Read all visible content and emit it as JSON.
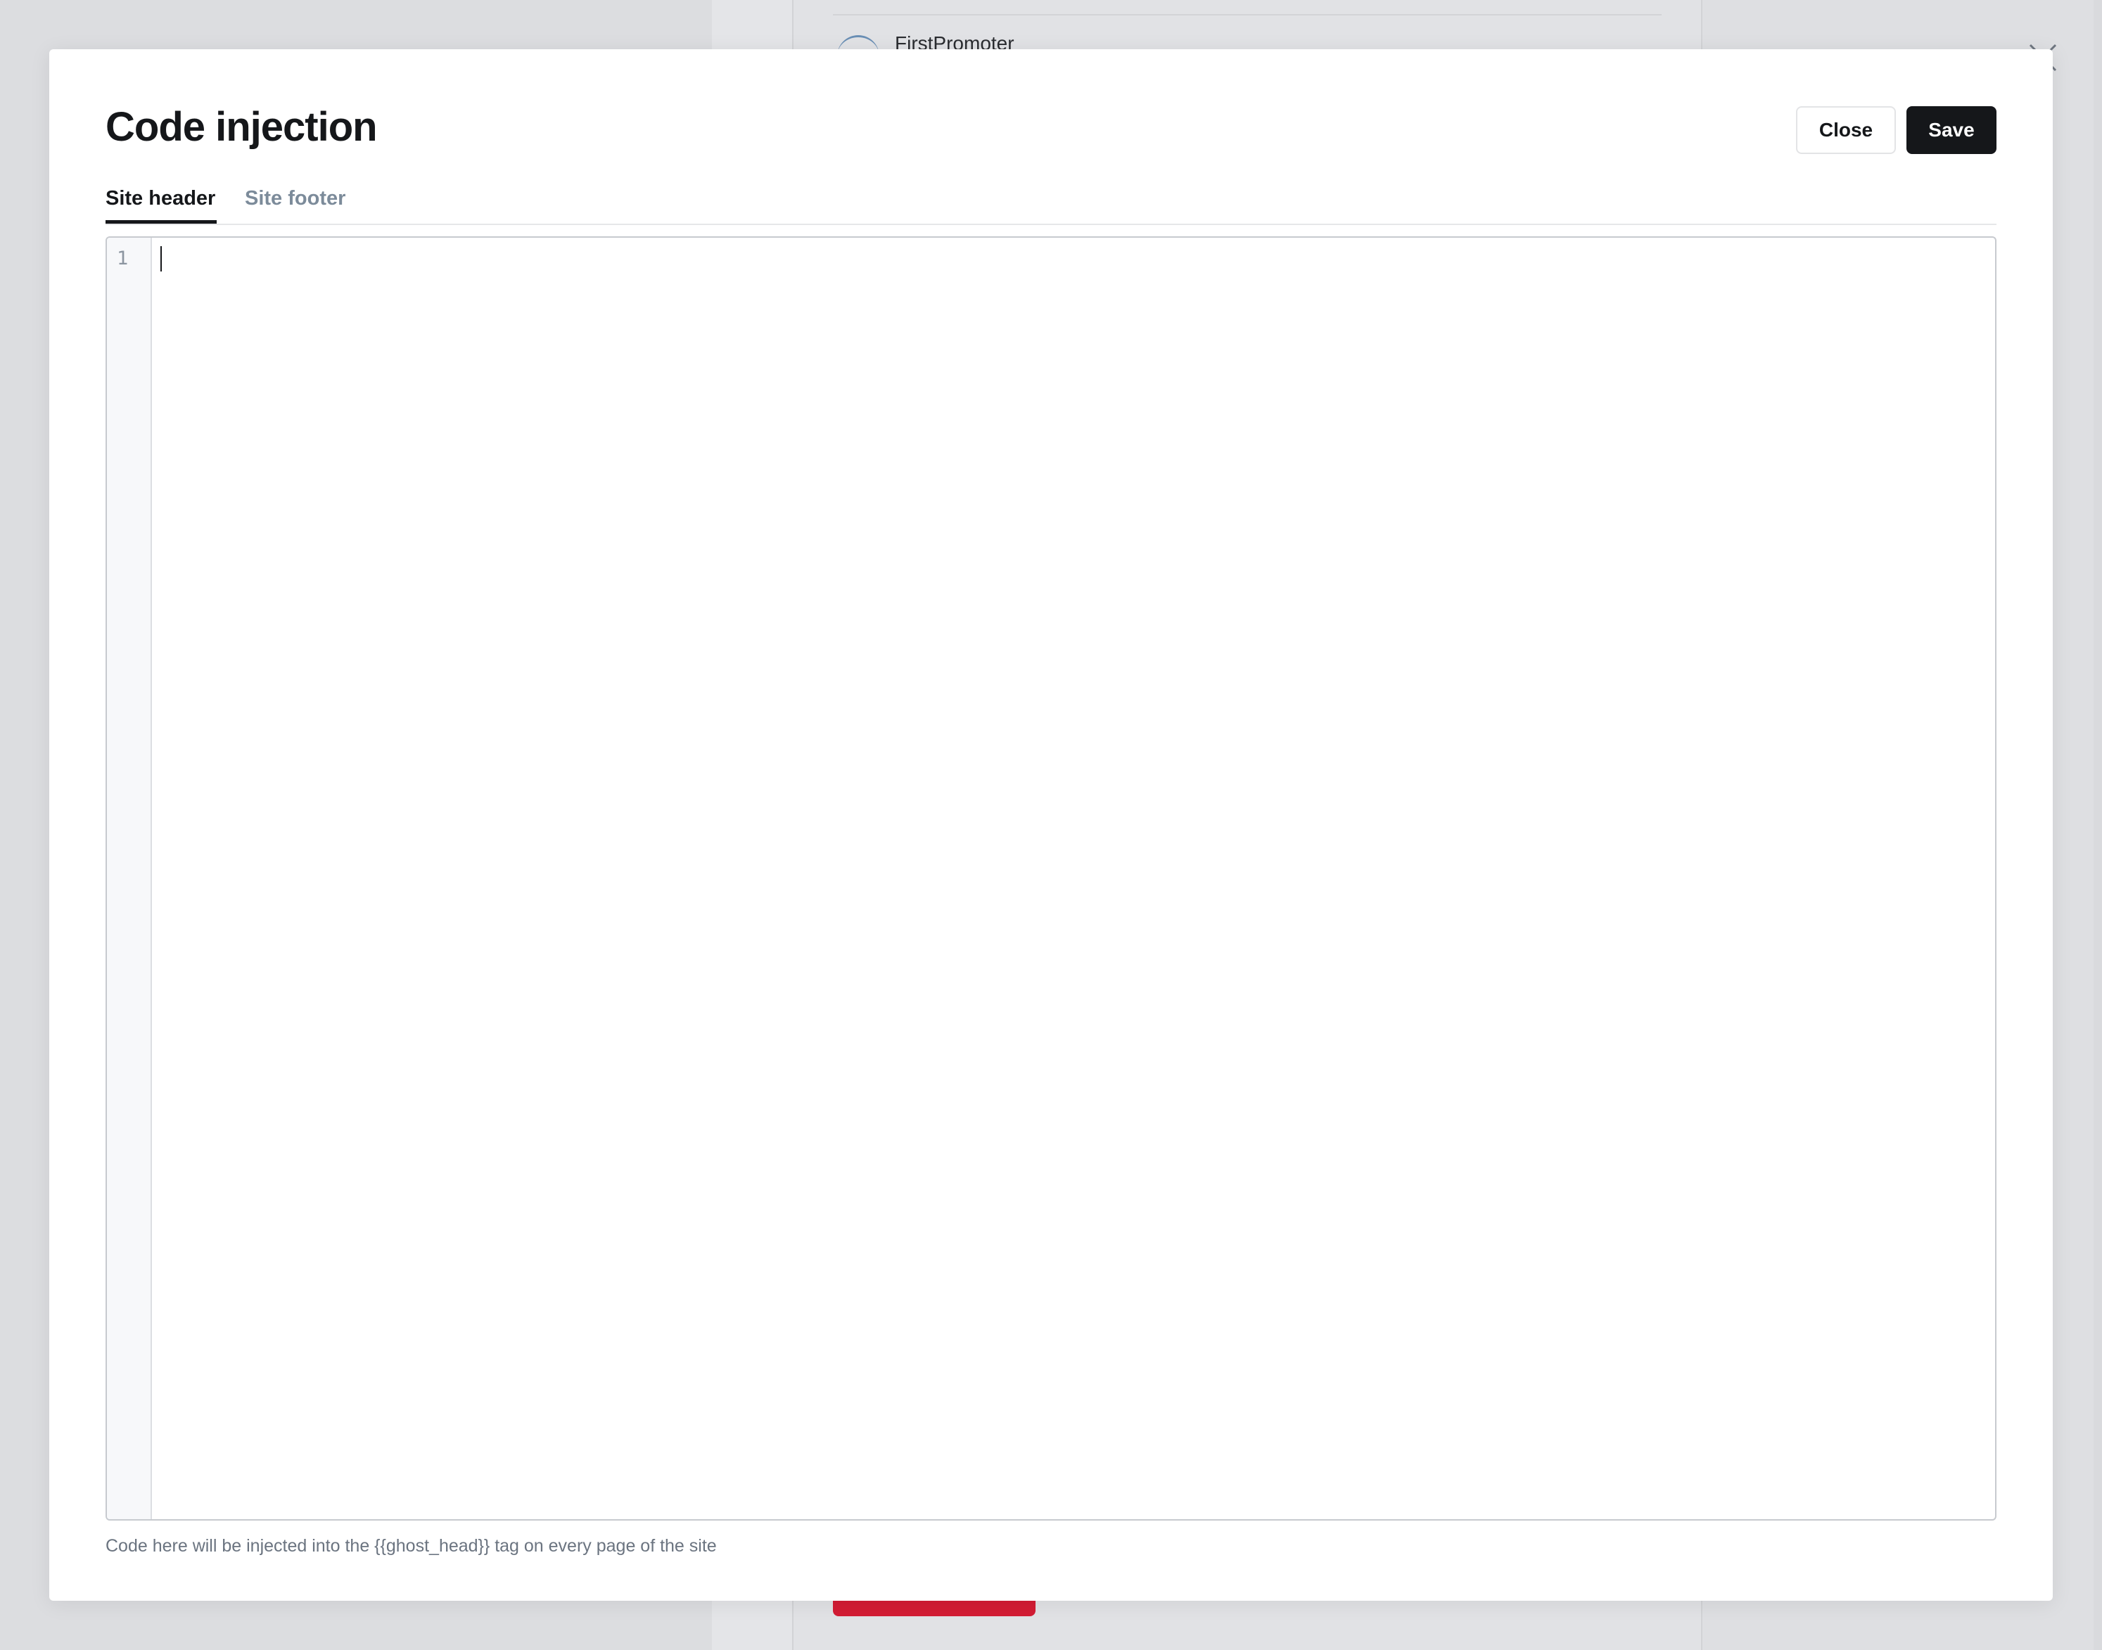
{
  "background": {
    "integration_item_name": "FirstPromoter"
  },
  "modal": {
    "title": "Code injection",
    "close_label": "Close",
    "save_label": "Save",
    "tabs": [
      {
        "label": "Site header",
        "active": true
      },
      {
        "label": "Site footer",
        "active": false
      }
    ],
    "editor": {
      "line_numbers": [
        "1"
      ],
      "content": ""
    },
    "hint": "Code here will be injected into the {{ghost_head}} tag on every page of the site"
  },
  "colors": {
    "primary_button": "#15171a",
    "danger_button": "#d31c34",
    "inactive_tab": "#7c8b9a"
  }
}
